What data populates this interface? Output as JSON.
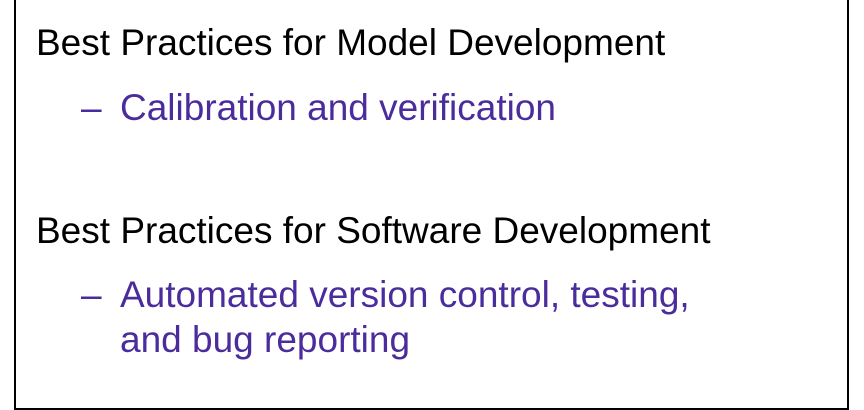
{
  "slide": {
    "sections": [
      {
        "heading": "Best Practices for Model Development",
        "bullet_marker": "–",
        "bullet_lines": [
          "Calibration and verification"
        ]
      },
      {
        "heading": "Best Practices for Software Development",
        "bullet_marker": "–",
        "bullet_lines": [
          "Automated version control, testing,",
          "and bug reporting"
        ]
      }
    ],
    "colors": {
      "heading": "#000000",
      "bullet": "#4b2c9c",
      "border": "#000000",
      "background": "#ffffff"
    }
  }
}
